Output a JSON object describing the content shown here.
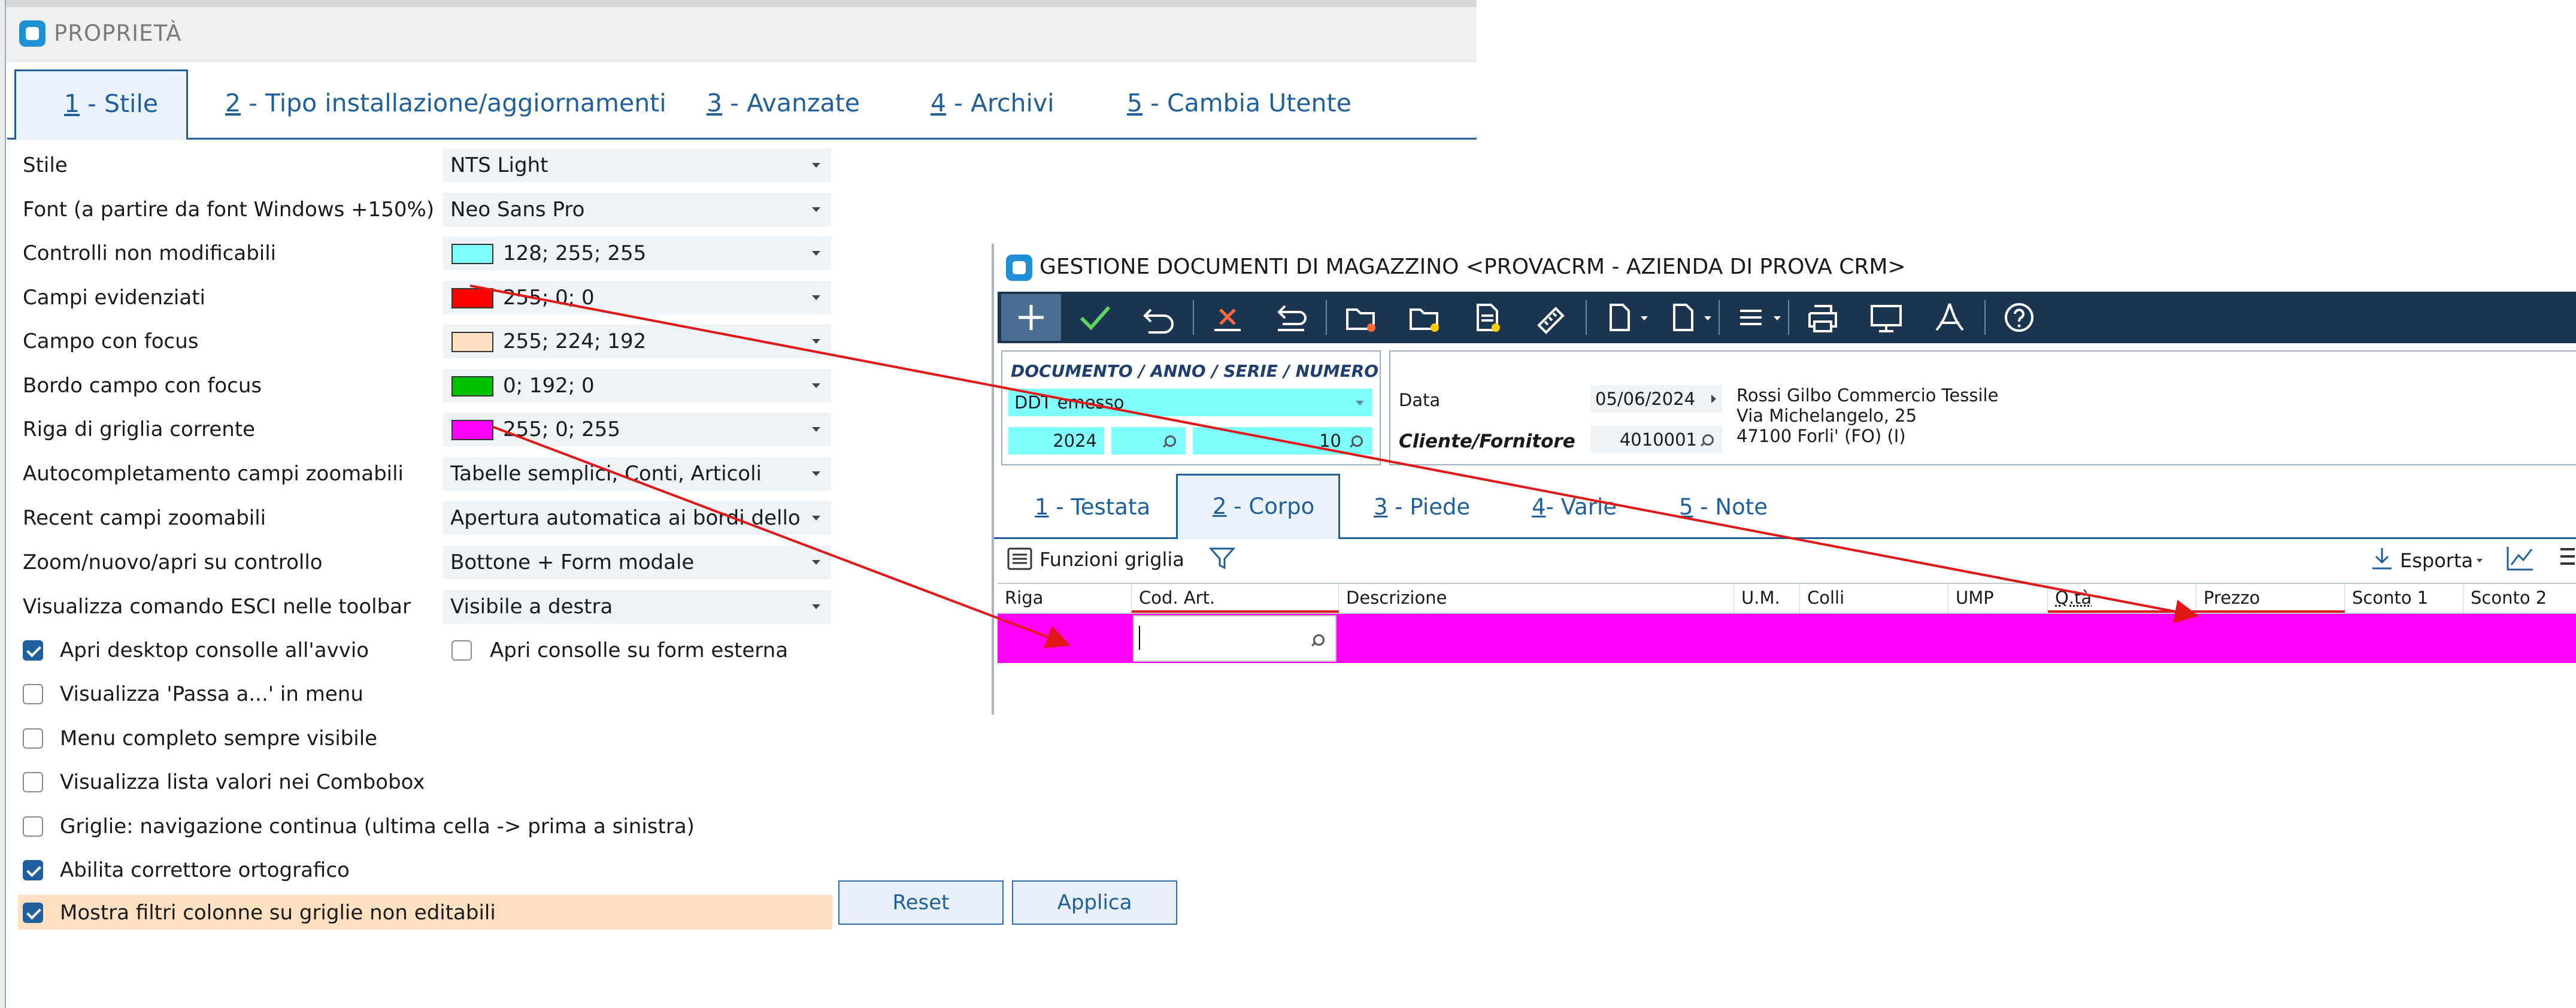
{
  "props": {
    "title": "PROPRIETÀ",
    "tabs": [
      {
        "acc": "1",
        "rest": " - Stile"
      },
      {
        "acc": "2",
        "rest": " - Tipo installazione/aggiornamenti"
      },
      {
        "acc": "3",
        "rest": " - Avanzate"
      },
      {
        "acc": "4",
        "rest": " - Archivi"
      },
      {
        "acc": "5",
        "rest": " - Cambia Utente"
      }
    ],
    "rows": [
      {
        "label": "Stile",
        "value": "NTS Light"
      },
      {
        "label": "Font (a partire da font Windows +150%)",
        "value": "Neo Sans Pro"
      },
      {
        "label": "Controlli non modificabili",
        "value": "128; 255; 255",
        "color": "#80ffff"
      },
      {
        "label": "Campi evidenziati",
        "value": "255; 0; 0",
        "color": "#ff0000"
      },
      {
        "label": "Campo con focus",
        "value": "255; 224; 192",
        "color": "#ffe0c0"
      },
      {
        "label": "Bordo campo con focus",
        "value": "0; 192; 0",
        "color": "#00c000"
      },
      {
        "label": "Riga di griglia corrente",
        "value": "255; 0; 255",
        "color": "#ff00ff"
      },
      {
        "label": "Autocompletamento campi zoomabili",
        "value": "Tabelle semplici, Conti, Articoli"
      },
      {
        "label": "Recent campi zoomabili",
        "value": "Apertura automatica ai bordi dello sch..."
      },
      {
        "label": "Zoom/nuovo/apri su controllo",
        "value": "Bottone + Form modale"
      },
      {
        "label": "Visualizza comando ESCI nelle toolbar",
        "value": "Visibile a destra"
      }
    ],
    "checks": [
      {
        "label": "Apri desktop consolle all'avvio",
        "checked": true
      },
      {
        "label": "Visualizza 'Passa a...' in menu",
        "checked": false
      },
      {
        "label": "Menu completo sempre visibile",
        "checked": false
      },
      {
        "label": "Visualizza lista valori nei Combobox",
        "checked": false
      },
      {
        "label": "Griglie: navigazione continua (ultima cella -> prima a sinistra)",
        "checked": false
      },
      {
        "label": "Abilita correttore ortografico",
        "checked": true
      },
      {
        "label": "Mostra filtri colonne su griglie non editabili",
        "checked": true
      }
    ],
    "side_check": {
      "label": "Apri consolle su form esterna",
      "checked": false
    },
    "buttons": {
      "reset": "Reset",
      "apply": "Applica"
    },
    "colors": {
      "accent": "#1f5f9e",
      "focus_row": "#ffe0c0"
    }
  },
  "wh": {
    "title": "GESTIONE DOCUMENTI DI MAGAZZINO <PROVACRM - AZIENDA DI PROVA CRM>",
    "toolbar_icons": [
      "plus-icon",
      "check-icon",
      "undo-icon",
      "delete-icon",
      "restore-icon",
      "folder-open-icon",
      "folder-new-icon",
      "document-edit-icon",
      "ruler-icon",
      "page-icon",
      "page-menu-icon",
      "hamburger-icon",
      "print-icon",
      "monitor-icon",
      "pdf-icon",
      "help-icon"
    ],
    "doc_header": {
      "title": "DOCUMENTO / ANNO / SERIE / NUMERO",
      "doc_type": "DDT emesso",
      "year": "2024",
      "serie": "",
      "number": "10"
    },
    "data_label": "Data",
    "data_value": "05/06/2024",
    "cliente_label": "Cliente/Fornitore",
    "cliente_code": "4010001",
    "cliente_address": [
      "Rossi Gilbo  Commercio Tessile",
      "Via Michelangelo, 25",
      "47100 Forli'  (FO)  (I)"
    ],
    "tabs": [
      {
        "acc": "1",
        "rest": " - Testata"
      },
      {
        "acc": "2",
        "rest": " - Corpo"
      },
      {
        "acc": "3",
        "rest": " - Piede"
      },
      {
        "acc": "4",
        "rest": "- Varie"
      },
      {
        "acc": "5",
        "rest": " - Note"
      }
    ],
    "grid_functions": "Funzioni griglia",
    "export": "Esporta",
    "columns": [
      "Riga",
      "Cod. Art.",
      "Descrizione",
      "U.M.",
      "Colli",
      "UMP",
      "Q.tà",
      "Prezzo",
      "Sconto 1",
      "Sconto 2"
    ],
    "row_color": "#ff00ff"
  }
}
